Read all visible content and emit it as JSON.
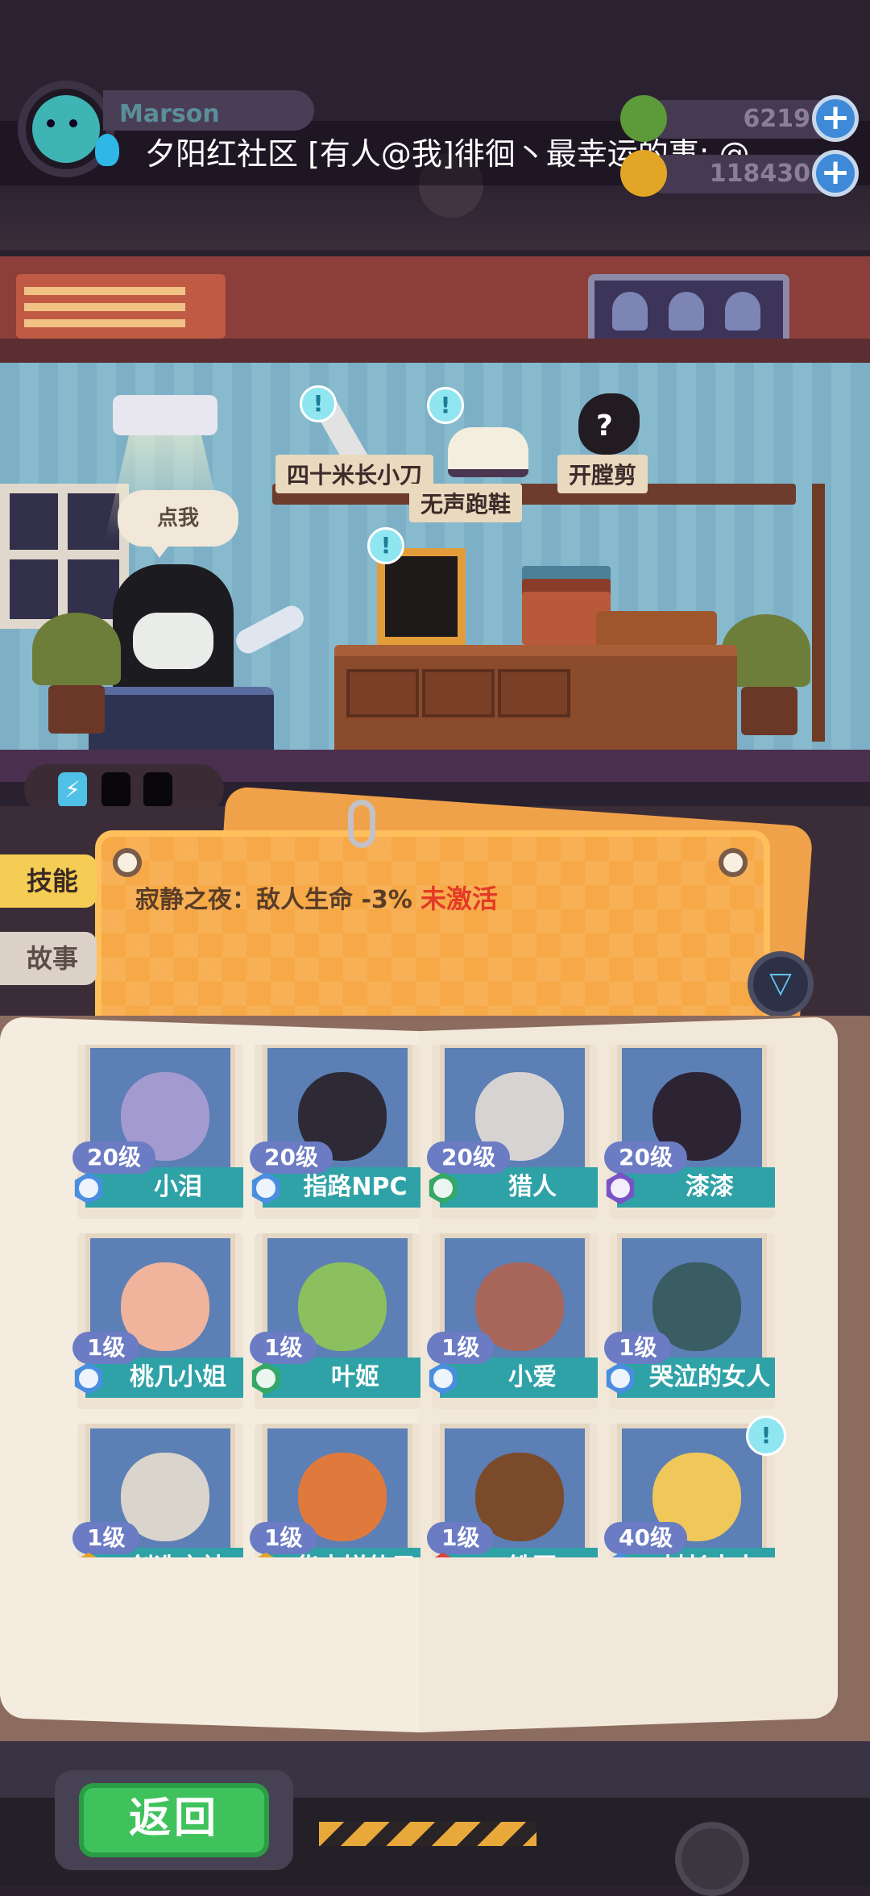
{
  "hud": {
    "player_name": "Marson",
    "currency": [
      {
        "name": "gems",
        "value": "6219",
        "icon": "green-coin-icon",
        "color": "#5c9a3a"
      },
      {
        "name": "gold",
        "value": "118430",
        "icon": "gold-coin-icon",
        "color": "#e3a526"
      }
    ],
    "add_label": "+"
  },
  "ticker": {
    "text": "夕阳红社区  [有人@我]徘徊丶最幸运的事: @..."
  },
  "room": {
    "items": [
      {
        "label": "四十米长小刀",
        "alert": "!"
      },
      {
        "label": "无声跑鞋",
        "alert": "!"
      },
      {
        "label": "开膛剪",
        "alert": "?"
      }
    ],
    "frame_alert": "!",
    "speech": "点我",
    "energy": {
      "active_icon": "⚡",
      "cells": 3,
      "active": 1
    }
  },
  "tabs": [
    {
      "label": "技能",
      "active": true
    },
    {
      "label": "故事",
      "active": false
    }
  ],
  "skill": {
    "text": "寂静之夜：敌人生命 -3%",
    "status": "未激活",
    "filter_icon": "filter-icon"
  },
  "characters": [
    {
      "name": "小泪",
      "level": "20级",
      "rarity_color": "#4a8ee0",
      "art": "#a39ad0"
    },
    {
      "name": "指路NPC",
      "level": "20级",
      "rarity_color": "#4a8ee0",
      "art": "#2d2a36"
    },
    {
      "name": "猎人",
      "level": "20级",
      "rarity_color": "#35a766",
      "art": "#d7d3d2"
    },
    {
      "name": "漆漆",
      "level": "20级",
      "rarity_color": "#7a52c7",
      "art": "#2c2333"
    },
    {
      "name": "桃几小姐",
      "level": "1级",
      "rarity_color": "#4a8ee0",
      "art": "#f0b39c"
    },
    {
      "name": "叶姬",
      "level": "1级",
      "rarity_color": "#35a766",
      "art": "#8cbf5e"
    },
    {
      "name": "小爱",
      "level": "1级",
      "rarity_color": "#4a8ee0",
      "art": "#a8655a"
    },
    {
      "name": "哭泣的女人",
      "level": "1级",
      "rarity_color": "#4a8ee0",
      "art": "#3a5c63"
    },
    {
      "name": "创造之神",
      "level": "1级",
      "rarity_color": "#e3a526",
      "art": "#d9d4cc"
    },
    {
      "name": "华丰饼仙子",
      "level": "1级",
      "rarity_color": "#e3a526",
      "art": "#e07a3c"
    },
    {
      "name": "铁匠",
      "level": "1级",
      "rarity_color": "#d9433a",
      "art": "#7a4a2a"
    },
    {
      "name": "村长夫人",
      "level": "40级",
      "rarity_color": "#4a8ee0",
      "art": "#f0c85a",
      "alert": "!"
    }
  ],
  "bottom": {
    "back_label": "返回"
  }
}
